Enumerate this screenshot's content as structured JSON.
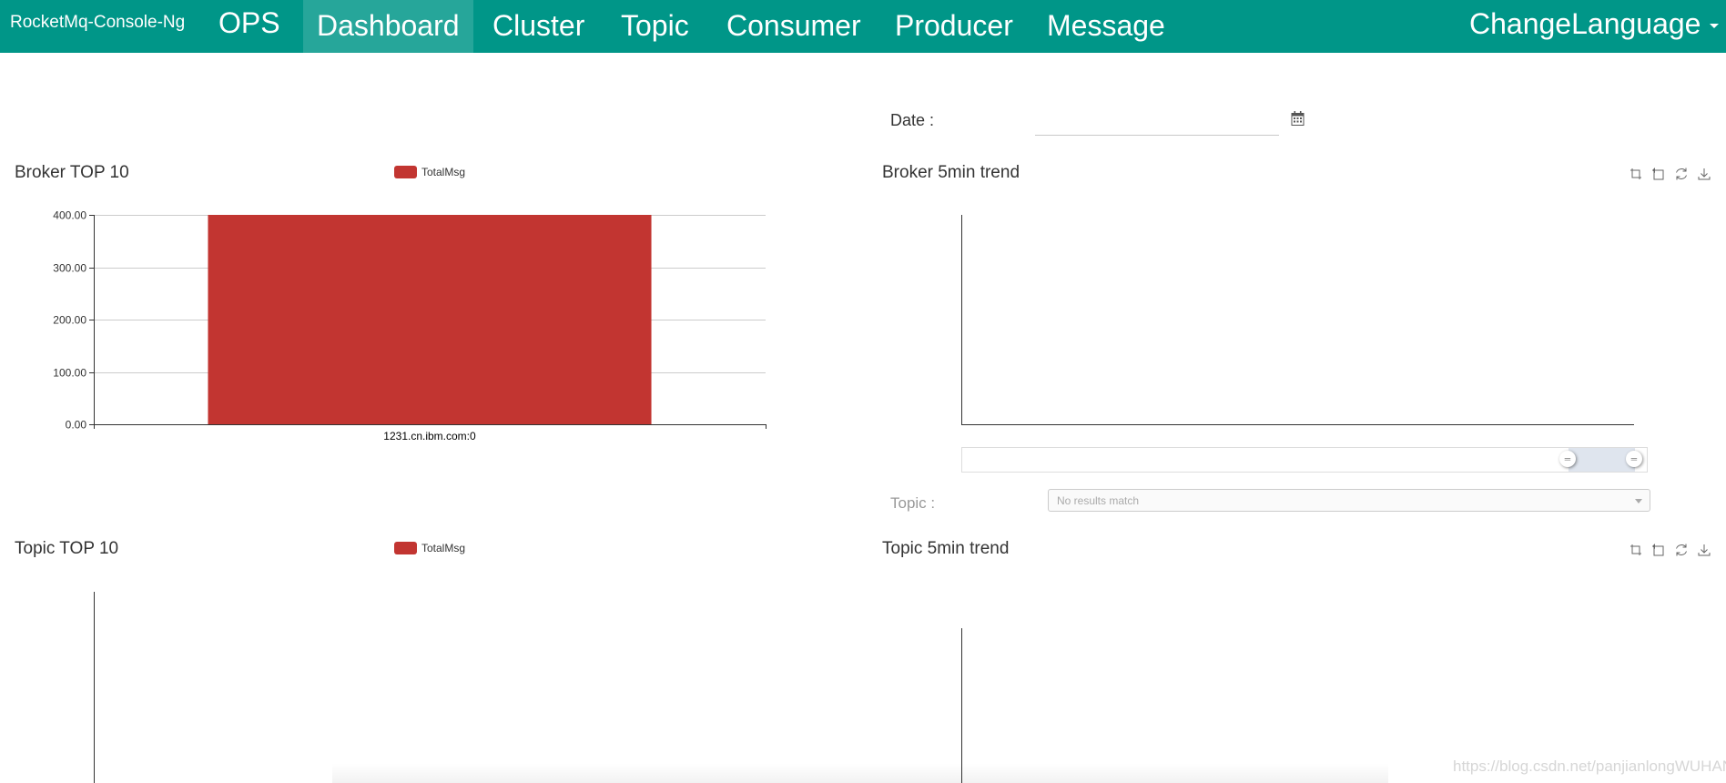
{
  "navbar": {
    "brand": "RocketMq-Console-Ng",
    "items": [
      {
        "label": "OPS"
      },
      {
        "label": "Dashboard",
        "active": true
      },
      {
        "label": "Cluster"
      },
      {
        "label": "Topic"
      },
      {
        "label": "Consumer"
      },
      {
        "label": "Producer"
      },
      {
        "label": "Message"
      }
    ],
    "language_menu": "ChangeLanguage",
    "color": "#009688",
    "active_color": "#26a69a"
  },
  "date": {
    "label": "Date :",
    "value": "",
    "icon": "calendar-icon"
  },
  "broker_top10": {
    "title": "Broker TOP 10",
    "legend": "TotalMsg"
  },
  "broker_trend": {
    "title": "Broker 5min trend"
  },
  "topic_top10": {
    "title": "Topic TOP 10",
    "legend": "TotalMsg"
  },
  "topic_trend": {
    "title": "Topic 5min trend"
  },
  "toolbox": {
    "icons": [
      "zoom-icon",
      "zoom-reset-icon",
      "restore-icon",
      "save-image-icon"
    ]
  },
  "topic_filter": {
    "label": "Topic :",
    "placeholder": "No results match"
  },
  "watermark": "https://blog.csdn.net/panjianlongWUHAN",
  "chart_data": [
    {
      "type": "bar",
      "title": "Broker TOP 10",
      "categories": [
        "1231.cn.ibm.com:0"
      ],
      "series": [
        {
          "name": "TotalMsg",
          "values": [
            400
          ],
          "color": "#c23531"
        }
      ],
      "ylim": [
        0,
        400
      ],
      "yticks": [
        "0.00",
        "100.00",
        "200.00",
        "300.00",
        "400.00"
      ],
      "grid": true,
      "legend": "top-center"
    },
    {
      "type": "line",
      "title": "Broker 5min trend",
      "series": []
    },
    {
      "type": "bar",
      "title": "Topic TOP 10",
      "categories": [],
      "series": [
        {
          "name": "TotalMsg",
          "values": []
        }
      ],
      "legend": "top-center"
    },
    {
      "type": "line",
      "title": "Topic 5min trend",
      "series": []
    }
  ]
}
